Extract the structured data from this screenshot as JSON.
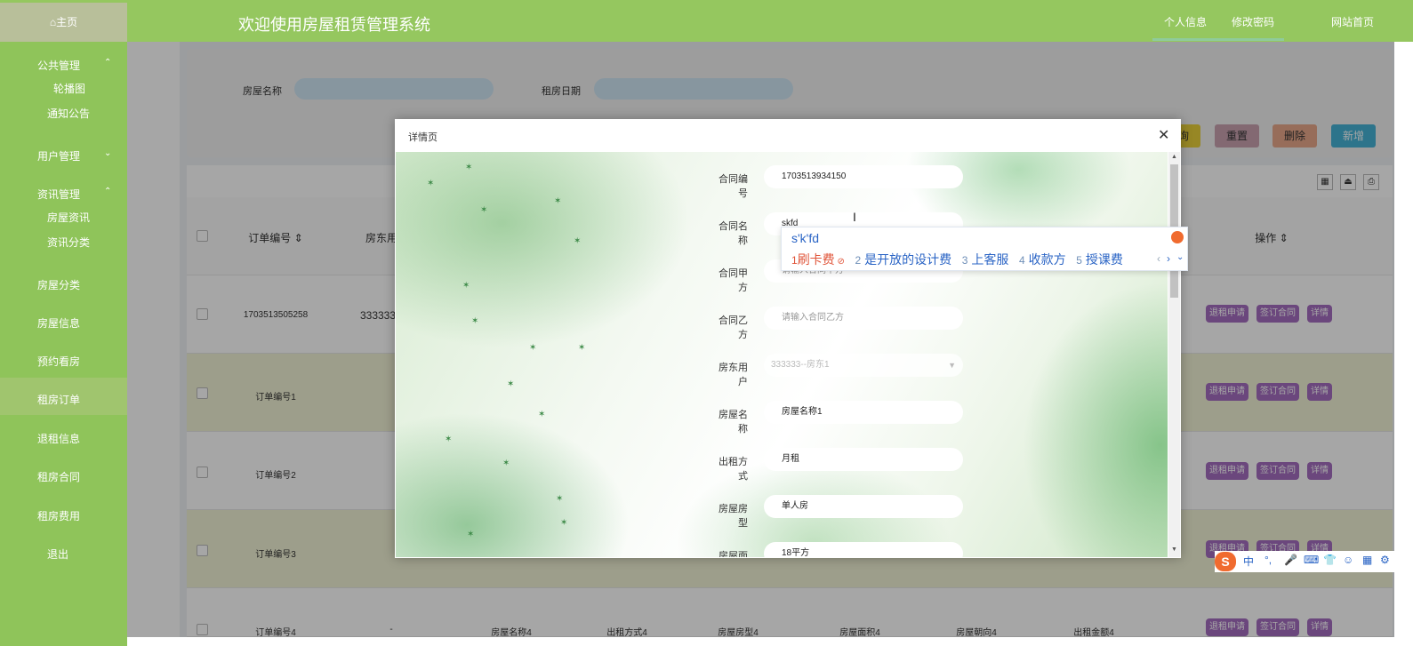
{
  "header": {
    "home_label": "⌂主页",
    "title": "欢迎使用房屋租赁管理系统",
    "links": [
      "个人信息",
      "修改密码",
      "网站首页"
    ]
  },
  "sidebar": {
    "groups": [
      {
        "label": "公共管理",
        "icon": "chevron-up-icon",
        "children": [
          "轮播图",
          "通知公告"
        ]
      },
      {
        "label": "用户管理",
        "icon": "chevron-down-icon",
        "children": []
      },
      {
        "label": "资讯管理",
        "icon": "chevron-up-icon",
        "children": [
          "房屋资讯",
          "资讯分类"
        ]
      }
    ],
    "items": [
      "房屋分类",
      "房屋信息",
      "预约看房",
      "租房订单",
      "退租信息",
      "租房合同",
      "租房费用",
      "退出"
    ]
  },
  "search": {
    "house_name_label": "房屋名称",
    "rent_date_label": "租房日期",
    "buttons": [
      "查询",
      "重置",
      "删除",
      "新增"
    ]
  },
  "table": {
    "headers": [
      "订单编号",
      "房东用户",
      "操作"
    ],
    "rows": [
      {
        "order_no": "1703513505258",
        "landlord": "333333",
        "cols": [
          "",
          "",
          "",
          "",
          "",
          ""
        ]
      },
      {
        "order_no": "订单编号1",
        "landlord": "",
        "cols": [
          "",
          "",
          "",
          "",
          "",
          ""
        ]
      },
      {
        "order_no": "订单编号2",
        "landlord": "",
        "cols": [
          "",
          "",
          "",
          "",
          "",
          ""
        ]
      },
      {
        "order_no": "订单编号3",
        "landlord": "",
        "cols": [
          "",
          "",
          "",
          "",
          "",
          ""
        ]
      },
      {
        "order_no": "订单编号4",
        "landlord": "-",
        "cols": [
          "房屋名称4",
          "出租方式4",
          "房屋房型4",
          "房屋面积4",
          "房屋朝向4",
          "出租金额4"
        ]
      }
    ],
    "actions": [
      "退租申请",
      "签订合同",
      "详情"
    ]
  },
  "modal": {
    "title": "详情页",
    "fields": [
      {
        "label": "合同编号",
        "value": "1703513934150",
        "placeholder": ""
      },
      {
        "label": "合同名称",
        "value": "skfd",
        "placeholder": ""
      },
      {
        "label": "合同甲方",
        "value": "",
        "placeholder": "请输入合同甲方"
      },
      {
        "label": "合同乙方",
        "value": "",
        "placeholder": "请输入合同乙方"
      },
      {
        "label": "房东用户",
        "value": "333333--房东1",
        "placeholder": ""
      },
      {
        "label": "房屋名称",
        "value": "房屋名称1",
        "placeholder": ""
      },
      {
        "label": "出租方式",
        "value": "月租",
        "placeholder": ""
      },
      {
        "label": "房屋房型",
        "value": "单人房",
        "placeholder": ""
      },
      {
        "label": "房屋面积",
        "value": "18平方",
        "placeholder": ""
      }
    ]
  },
  "ime": {
    "input": "s'k'fd",
    "candidates": [
      {
        "num": "1",
        "text": "刷卡费"
      },
      {
        "num": "2",
        "text": "是开放的设计费"
      },
      {
        "num": "3",
        "text": "上客服"
      },
      {
        "num": "4",
        "text": "收款方"
      },
      {
        "num": "5",
        "text": "授课费"
      }
    ],
    "toolbar_logo": "S",
    "toolbar_mode": "中",
    "toolbar_punct": "°,"
  },
  "colors": {
    "header_green": "#95c75f",
    "sidebar_green": "#8fc45a",
    "action_purple": "#a56ec0",
    "btn_reset": "#c9a1b0",
    "btn_delete": "#e9a88a",
    "btn_add": "#45b3d6",
    "btn_search": "#e8cf3a"
  }
}
